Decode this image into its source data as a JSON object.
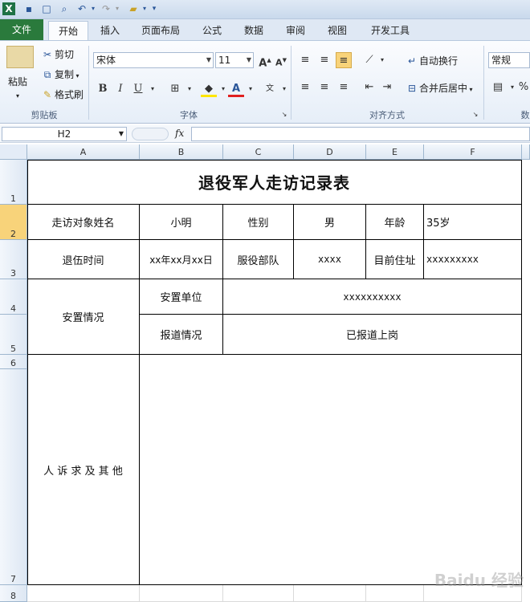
{
  "ribbon": {
    "tabs": [
      "文件",
      "开始",
      "插入",
      "页面布局",
      "公式",
      "数据",
      "审阅",
      "视图",
      "开发工具"
    ],
    "clipboard": {
      "paste": "粘贴",
      "cut": "剪切",
      "copy": "复制",
      "format_painter": "格式刷",
      "label": "剪贴板"
    },
    "font": {
      "name": "宋体",
      "size": "11",
      "label": "字体"
    },
    "alignment": {
      "wrap_text": "自动换行",
      "merge_center": "合并后居中",
      "label": "对齐方式"
    },
    "number": {
      "format": "常规",
      "label": "数"
    }
  },
  "formula_bar": {
    "name_box": "H2",
    "fx": "fx",
    "content": ""
  },
  "sheet": {
    "columns": [
      "A",
      "B",
      "C",
      "D",
      "E",
      "F"
    ],
    "rows": [
      "1",
      "2",
      "3",
      "4",
      "5",
      "6",
      "7",
      "8"
    ],
    "title": "退役军人走访记录表",
    "row2": {
      "label_name": "走访对象姓名",
      "name": "小明",
      "label_gender": "性别",
      "gender": "男",
      "label_age": "年龄",
      "age": "35岁"
    },
    "row3": {
      "label_discharge": "退伍时间",
      "discharge": "xx年xx月xx日",
      "label_unit": "服役部队",
      "unit": "xxxx",
      "label_address": "目前住址",
      "address": "xxxxxxxxx"
    },
    "placement": {
      "label": "安置情况",
      "label_unit": "安置单位",
      "unit": "xxxxxxxxxx",
      "label_report": "报道情况",
      "report": "已报道上岗"
    },
    "appeal": {
      "label": "人 诉 求 及 其 他"
    }
  },
  "watermark": "Baidu 经验"
}
